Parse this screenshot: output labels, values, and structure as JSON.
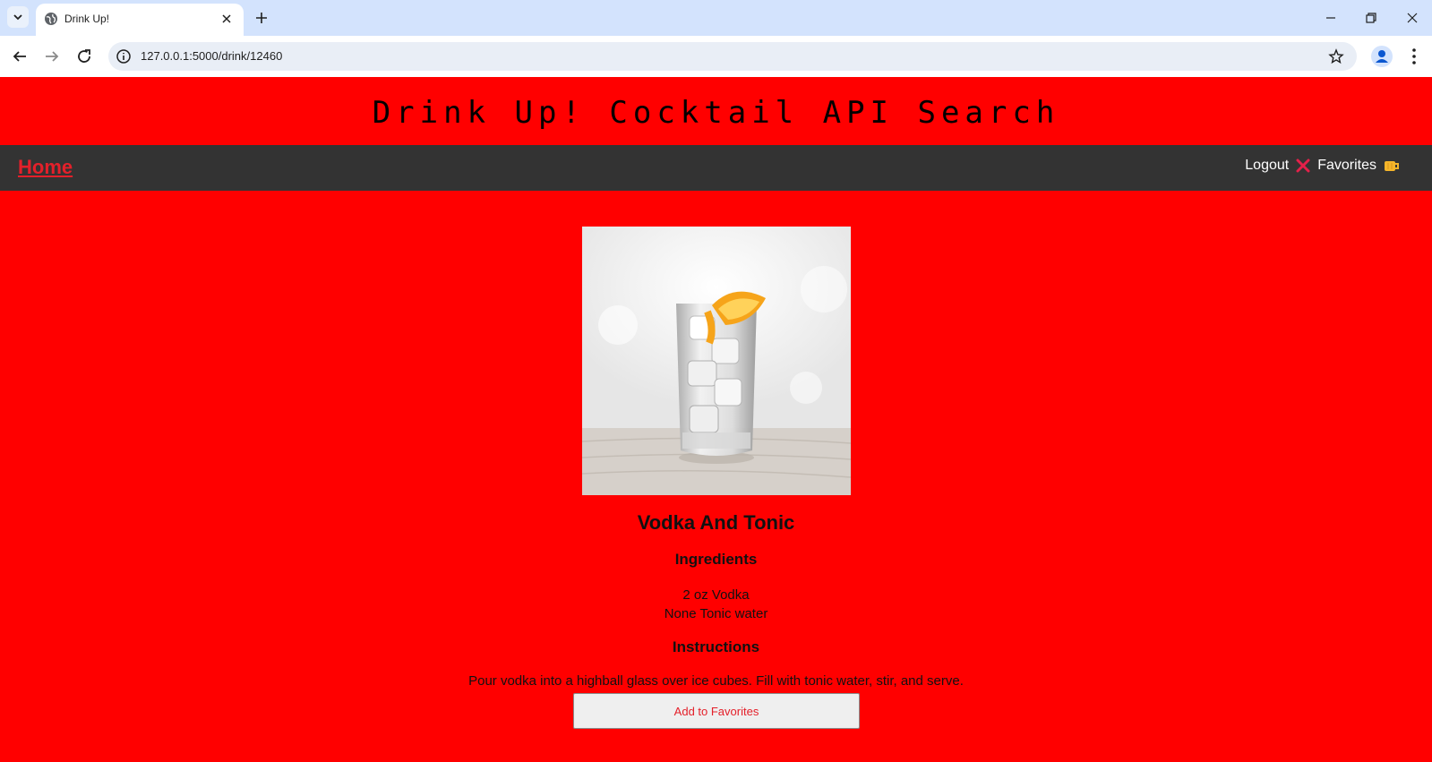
{
  "browser": {
    "tab_title": "Drink Up!",
    "url": "127.0.0.1:5000/drink/12460"
  },
  "header": {
    "site_title": "Drink Up! Cocktail API Search"
  },
  "nav": {
    "home": "Home",
    "logout": "Logout",
    "favorites": "Favorites"
  },
  "drink": {
    "name": "Vodka And Tonic",
    "ingredients_heading": "Ingredients",
    "ingredients": [
      "2 oz Vodka",
      "None Tonic water"
    ],
    "instructions_heading": "Instructions",
    "instructions": "Pour vodka into a highball glass over ice cubes. Fill with tonic water, stir, and serve.",
    "add_button": "Add to Favorites"
  },
  "colors": {
    "page_bg": "#ff0000",
    "navbar_bg": "#333333",
    "home_link": "#e4202a",
    "x_icon": "#e4204a",
    "beer_icon": "#f5b52a"
  },
  "icons": {
    "logout": "x-icon",
    "favorites": "beer-mug-icon"
  }
}
